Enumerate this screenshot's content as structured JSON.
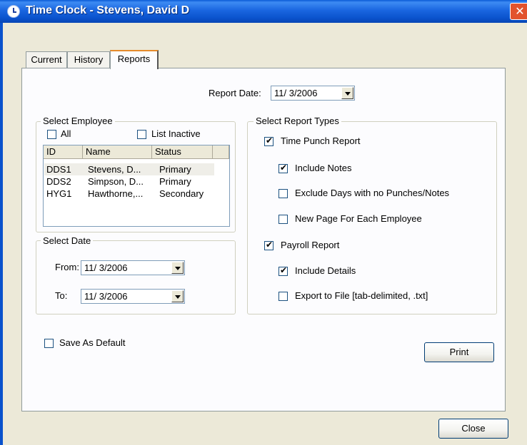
{
  "window": {
    "title": "Time Clock - Stevens, David D",
    "close_glyph": "✕"
  },
  "tabs": [
    {
      "label": "Current"
    },
    {
      "label": "History"
    },
    {
      "label": "Reports"
    }
  ],
  "report_date": {
    "label": "Report Date:",
    "value": "11/ 3/2006"
  },
  "select_employee": {
    "title": "Select Employee",
    "all_label": "All",
    "all_checked": false,
    "inactive_label": "List Inactive",
    "inactive_checked": false,
    "columns": [
      "ID",
      "Name",
      "Status"
    ],
    "rows": [
      {
        "id": "DDS1",
        "name": "Stevens, D...",
        "status": "Primary"
      },
      {
        "id": "DDS2",
        "name": "Simpson, D...",
        "status": "Primary"
      },
      {
        "id": "HYG1",
        "name": "Hawthorne,...",
        "status": "Secondary"
      }
    ]
  },
  "select_date": {
    "title": "Select Date",
    "from_label": "From:",
    "from_value": "11/ 3/2006",
    "to_label": "To:",
    "to_value": "11/ 3/2006"
  },
  "report_types": {
    "title": "Select Report Types",
    "time_punch": {
      "label": "Time Punch Report",
      "checked": true
    },
    "include_notes": {
      "label": "Include Notes",
      "checked": true
    },
    "exclude_days": {
      "label": "Exclude Days with no Punches/Notes",
      "checked": false
    },
    "new_page": {
      "label": "New Page For Each Employee",
      "checked": false
    },
    "payroll": {
      "label": "Payroll Report",
      "checked": true
    },
    "include_details": {
      "label": "Include Details",
      "checked": true
    },
    "export": {
      "label": "Export to File [tab-delimited, .txt]",
      "checked": false
    }
  },
  "save_default": {
    "label": "Save As Default",
    "checked": false
  },
  "buttons": {
    "print": "Print",
    "close": "Close"
  },
  "colors": {
    "titlebar": "#0a52cc",
    "dialog_bg": "#ece9d8",
    "panel_bg": "#fcfcfe",
    "close_button": "#e2532e"
  }
}
